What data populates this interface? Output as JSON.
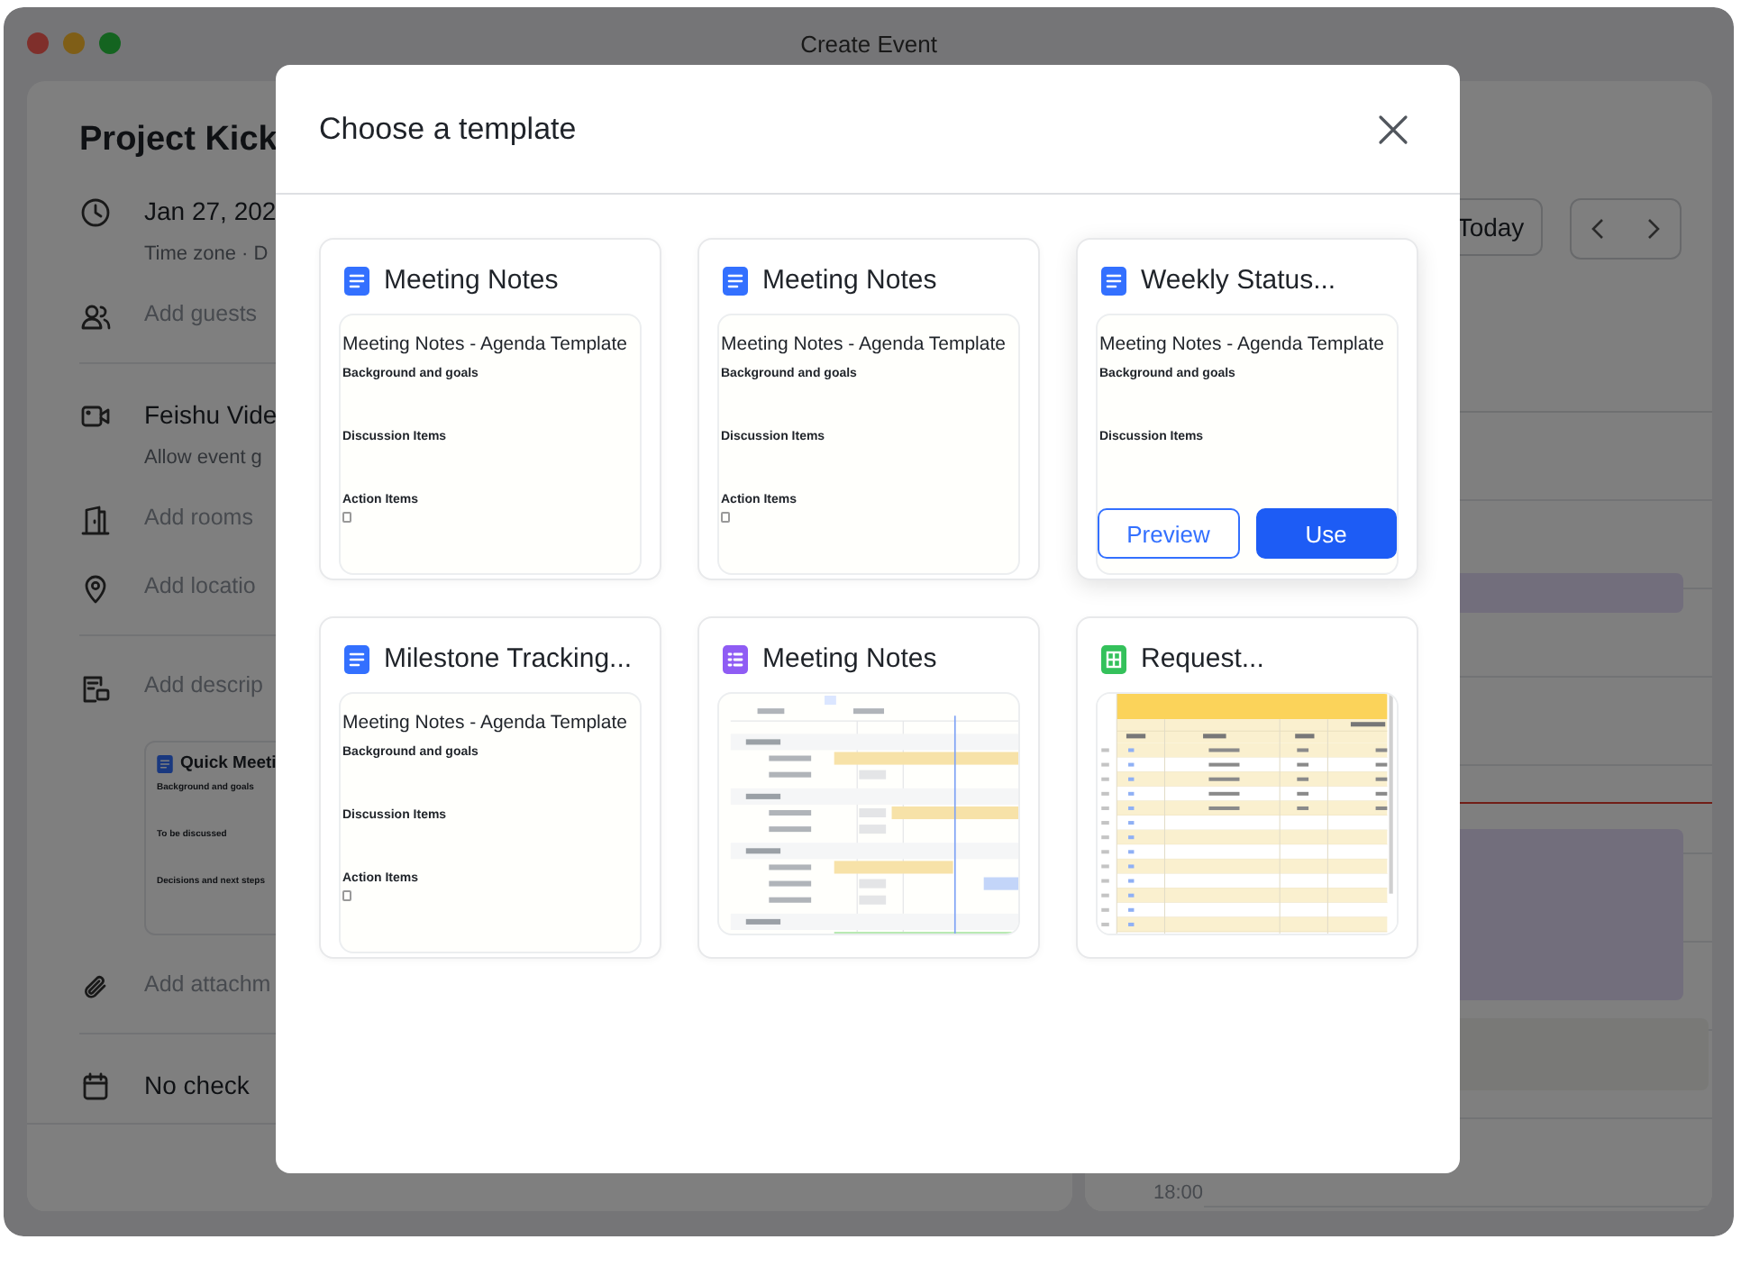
{
  "window": {
    "title": "Create Event"
  },
  "event_form": {
    "title": "Project Kick",
    "sections": [
      [
        {
          "kind": "time",
          "value": "Jan 27, 202",
          "note": "Time zone · D"
        },
        {
          "kind": "guests",
          "placeholder": "Add guests"
        }
      ],
      [
        {
          "kind": "video",
          "value": "Feishu Vide",
          "note": "Allow event g"
        },
        {
          "kind": "room",
          "placeholder": "Add rooms"
        },
        {
          "kind": "location",
          "placeholder": "Add locatio"
        }
      ],
      [
        {
          "kind": "description",
          "placeholder": "Add descrip",
          "attachment": {
            "title": "Quick Meeti",
            "sections": [
              "Background and goals",
              "To be discussed",
              "Decisions and next steps"
            ]
          }
        },
        {
          "kind": "attachment",
          "placeholder": "Add attachm"
        }
      ],
      [
        {
          "kind": "checkin",
          "value": "No check"
        }
      ]
    ]
  },
  "calendar": {
    "today_button": "Today",
    "time_label": "18:00"
  },
  "modal": {
    "title": "Choose a template",
    "preview_button": "Preview",
    "use_button": "Use",
    "templates": [
      {
        "kind": "doc",
        "name": "Meeting Notes",
        "hovered": false,
        "preview": {
          "title": "Meeting Notes - Agenda Template",
          "sections": [
            "Background and goals",
            "Discussion Items",
            "Action Items"
          ],
          "todo_checked": false
        }
      },
      {
        "kind": "doc",
        "name": "Meeting Notes",
        "hovered": false,
        "preview": {
          "title": "Meeting Notes - Agenda Template",
          "sections": [
            "Background and goals",
            "Discussion Items",
            "Action Items"
          ],
          "todo_checked": false
        }
      },
      {
        "kind": "doc",
        "name": "Weekly Status...",
        "hovered": true,
        "preview": {
          "title": "Meeting Notes - Agenda Template",
          "sections": [
            "Background and goals",
            "Discussion Items"
          ]
        }
      },
      {
        "kind": "doc",
        "name": "Milestone Tracking...",
        "hovered": false,
        "preview": {
          "title": "Meeting Notes - Agenda Template",
          "sections": [
            "Background and goals",
            "Discussion Items",
            "Action Items"
          ],
          "todo_checked": false
        }
      },
      {
        "kind": "base",
        "name": "Meeting Notes",
        "hovered": false
      },
      {
        "kind": "sheet",
        "name": "Request...",
        "hovered": false
      }
    ]
  }
}
